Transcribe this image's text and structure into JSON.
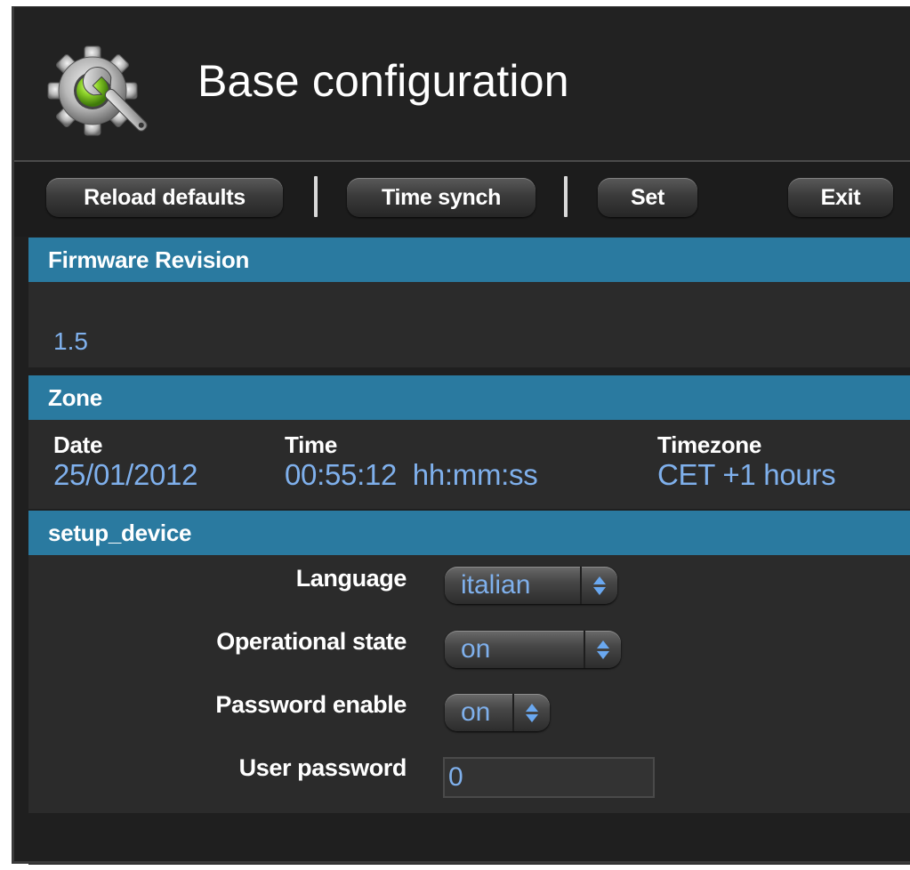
{
  "header": {
    "title": "Base configuration",
    "icon": "gear-wrench-icon"
  },
  "toolbar": {
    "reload_label": "Reload defaults",
    "time_synch_label": "Time synch",
    "set_label": "Set",
    "exit_label": "Exit"
  },
  "firmware": {
    "heading": "Firmware Revision",
    "value": "1.5"
  },
  "zone": {
    "heading": "Zone",
    "date_label": "Date",
    "date_value": "25/01/2012",
    "time_label": "Time",
    "time_value": "00:55:12  hh:mm:ss",
    "timezone_label": "Timezone",
    "timezone_value": "CET +1 hours"
  },
  "setup_device": {
    "heading": "setup_device",
    "language_label": "Language",
    "language_value": "italian",
    "operational_state_label": "Operational state",
    "operational_state_value": "on",
    "password_enable_label": "Password enable",
    "password_enable_value": "on",
    "user_password_label": "User password",
    "user_password_value": "0"
  },
  "colors": {
    "section_bar": "#2a7aa0",
    "value_text": "#7fb0ec",
    "background": "#1f1f1f"
  }
}
